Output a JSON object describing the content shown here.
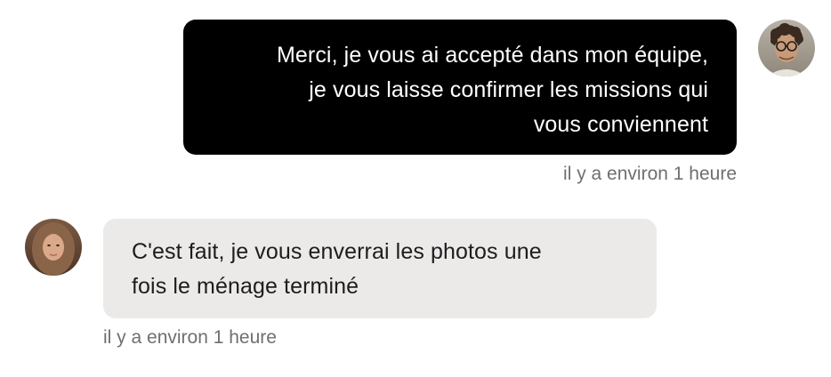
{
  "messages": [
    {
      "direction": "sent",
      "text_lines": [
        "Merci, je vous ai accepté dans mon équipe,",
        "je vous laisse confirmer les missions qui",
        "vous conviennent"
      ],
      "timestamp": "il y a environ 1 heure",
      "bubble_color": "#000000",
      "text_color": "#ffffff"
    },
    {
      "direction": "received",
      "text_lines": [
        "C'est fait, je vous enverrai les photos une",
        "fois le ménage terminé"
      ],
      "timestamp": "il y a environ 1 heure",
      "bubble_color": "#ebeae9",
      "text_color": "#1d1d1f"
    }
  ],
  "timestamp_color": "#6f6f73"
}
